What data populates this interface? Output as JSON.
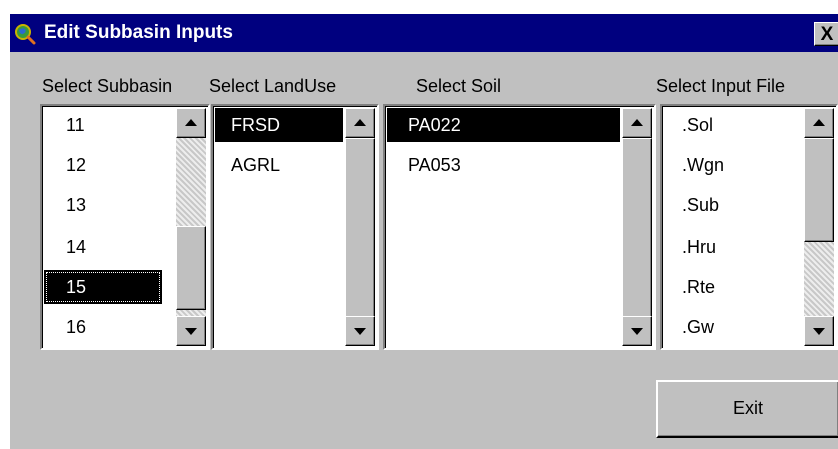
{
  "window": {
    "title": "Edit Subbasin Inputs",
    "close_label": "X"
  },
  "subbasin": {
    "caption": "Select Subbasin",
    "items": [
      "11",
      "12",
      "13",
      "14",
      "15",
      "16"
    ],
    "selected": "15"
  },
  "landuse": {
    "caption": "Select LandUse",
    "items": [
      "FRSD",
      "AGRL"
    ],
    "selected": "FRSD"
  },
  "soil": {
    "caption": "Select Soil",
    "items": [
      "PA022",
      "PA053"
    ],
    "selected": "PA022"
  },
  "inputfile": {
    "caption": "Select Input File",
    "items": [
      ".Sol",
      ".Wgn",
      ".Sub",
      ".Hru",
      ".Rte",
      ".Gw"
    ]
  },
  "exit_label": "Exit",
  "colors": {
    "titlebar": "#00007f",
    "face": "#c0c0c0",
    "selection": "#000000"
  }
}
